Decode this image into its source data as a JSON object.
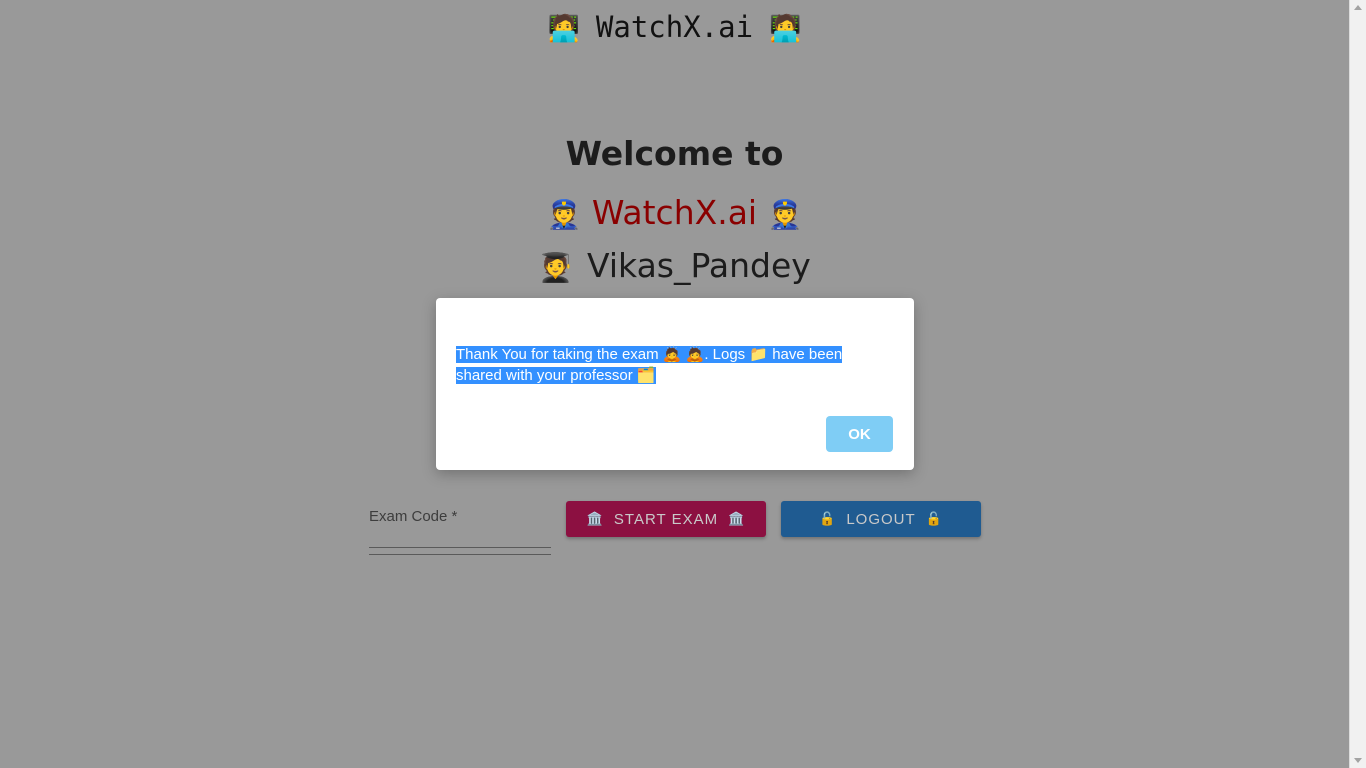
{
  "header": {
    "title": "WatchX.ai",
    "left_emoji": "🧑‍💻",
    "right_emoji": "🧑‍💻"
  },
  "main": {
    "welcome_text": "Welcome to",
    "brand_name": "WatchX.ai",
    "brand_emoji": "👮",
    "user_emoji": "🧑‍🎓",
    "username": "Vikas_Pandey",
    "exam_code_label": "Exam Code *",
    "start_exam_label": "START EXAM",
    "start_exam_emoji": "🏛️",
    "logout_label": "LOGOUT",
    "logout_emoji": "🔓"
  },
  "dialog": {
    "message_part1": "Thank You for taking the exam 🙇 🙇. Logs 📁 have been",
    "message_part2": "shared with your professor 🗂️",
    "ok_label": "OK"
  },
  "colors": {
    "overlay_background": "#999999",
    "brand_text": "#8a0000",
    "start_exam_button": "#8c1041",
    "logout_button": "#1f5b91",
    "ok_button": "#7fcdf5",
    "selection_highlight": "#3390ff"
  }
}
